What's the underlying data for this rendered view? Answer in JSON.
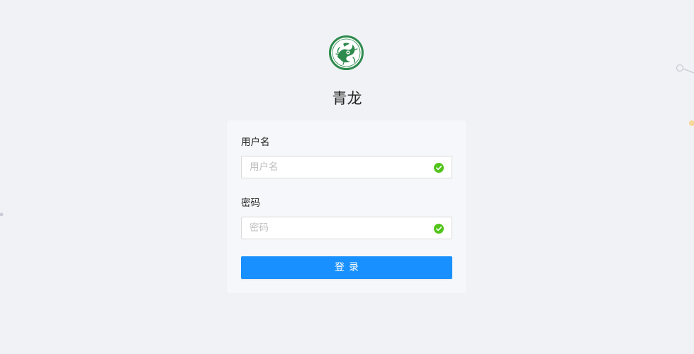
{
  "app": {
    "title": "青龙",
    "logo_icon": "qinglong-dragon-logo",
    "brand_color": "#2e8b4e"
  },
  "login_form": {
    "username_label": "用户名",
    "username_placeholder": "用户名",
    "username_value": "",
    "password_label": "密码",
    "password_placeholder": "密码",
    "password_value": "",
    "submit_label": "登录",
    "submit_color": "#1890ff",
    "valid_icon": "check-circle-icon",
    "valid_color": "#52c41a"
  },
  "background": {
    "color": "#f0f2f5"
  }
}
